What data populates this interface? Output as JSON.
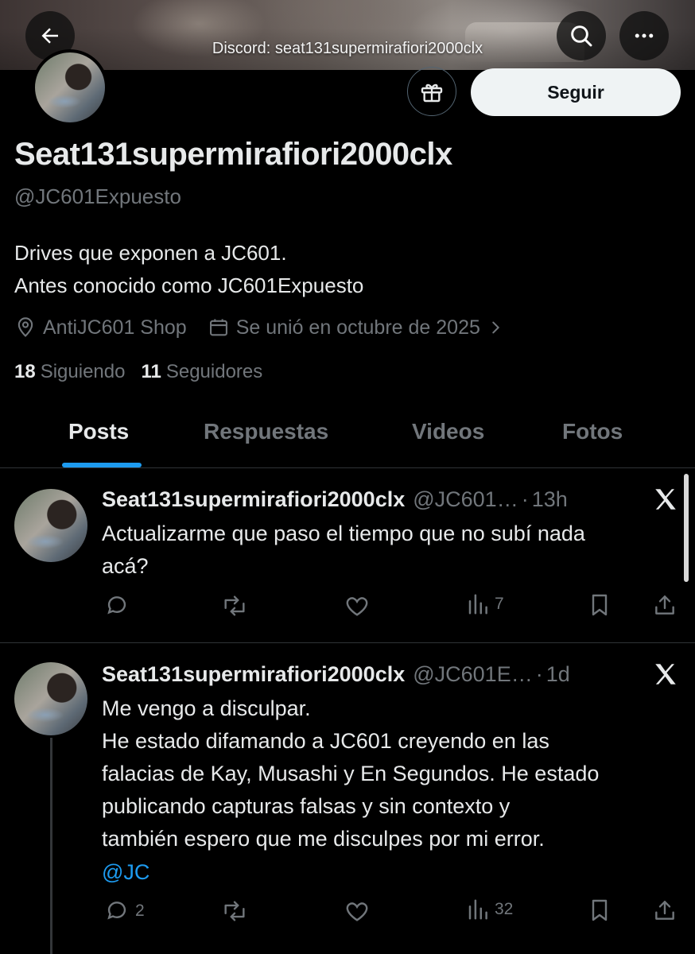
{
  "header": {
    "discord_label": "Discord: seat131supermirafiori2000clx",
    "icons": {
      "back": "arrow-left-icon",
      "search": "search-icon",
      "more": "more-horizontal-icon"
    }
  },
  "profile": {
    "display_name": "Seat131supermirafiori2000clx",
    "handle": "@JC601Expuesto",
    "bio_line1": "Drives que exponen a JC601.",
    "bio_line2": "Antes conocido como JC601Expuesto",
    "location": "AntiJC601 Shop",
    "joined": "Se unió en octubre de 2025",
    "following_count": "18",
    "following_label": "Siguiendo",
    "followers_count": "11",
    "followers_label": "Seguidores",
    "follow_button": "Seguir",
    "gift_icon": "gift-icon"
  },
  "tabs": [
    {
      "label": "Posts",
      "active": true
    },
    {
      "label": "Respuestas",
      "active": false
    },
    {
      "label": "Videos",
      "active": false
    },
    {
      "label": "Fotos",
      "active": false
    }
  ],
  "posts": [
    {
      "author": "Seat131supermirafiori2000clx",
      "handle": "@JC601…",
      "separator": "·",
      "time": "13h",
      "text": "Actualizarme que paso el tiempo que no subí nada\nacá?",
      "mention": "",
      "replies": "",
      "reposts": "",
      "likes": "",
      "views": "7"
    },
    {
      "author": "Seat131supermirafiori2000clx",
      "handle": "@JC601E…",
      "separator": "·",
      "time": "1d",
      "text": "Me vengo a disculpar.\nHe estado difamando a JC601 creyendo en las\nfalacias de Kay, Musashi y En Segundos. He estado\npublicando capturas falsas y sin contexto y\ntambién espero que me disculpes por mi error.",
      "mention": "@JC",
      "replies": "2",
      "reposts": "",
      "likes": "",
      "views": "32"
    }
  ],
  "colors": {
    "background": "#000000",
    "text_primary": "#e7e9ea",
    "text_secondary": "#71767b",
    "accent": "#1d9bf0",
    "divider": "#2f3336"
  }
}
